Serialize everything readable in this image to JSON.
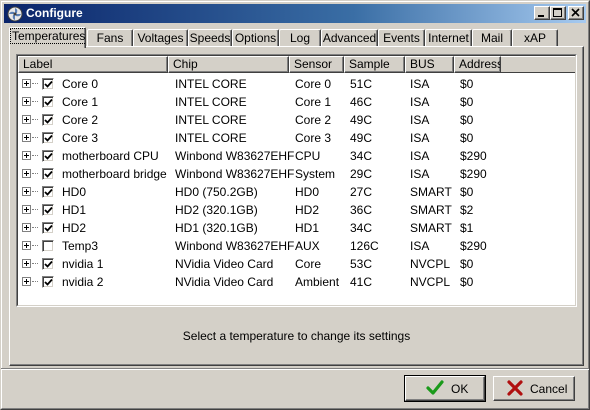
{
  "window": {
    "title": "Configure",
    "icon": "fan-icon",
    "controls": [
      "minimize-icon",
      "maximize-icon",
      "close-icon"
    ]
  },
  "tabs": [
    {
      "label": "Temperatures",
      "active": true
    },
    {
      "label": "Fans"
    },
    {
      "label": "Voltages"
    },
    {
      "label": "Speeds"
    },
    {
      "label": "Options"
    },
    {
      "label": "Log"
    },
    {
      "label": "Advanced"
    },
    {
      "label": "Events"
    },
    {
      "label": "Internet"
    },
    {
      "label": "Mail"
    },
    {
      "label": "xAP"
    }
  ],
  "list": {
    "columns": [
      "Label",
      "Chip",
      "Sensor",
      "Sample",
      "BUS",
      "Address"
    ],
    "rows": [
      {
        "label": "Core 0",
        "checked": true,
        "chip": "INTEL CORE",
        "sensor": "Core 0",
        "sample": "51C",
        "bus": "ISA",
        "address": "$0"
      },
      {
        "label": "Core 1",
        "checked": true,
        "chip": "INTEL CORE",
        "sensor": "Core 1",
        "sample": "46C",
        "bus": "ISA",
        "address": "$0"
      },
      {
        "label": "Core 2",
        "checked": true,
        "chip": "INTEL CORE",
        "sensor": "Core 2",
        "sample": "49C",
        "bus": "ISA",
        "address": "$0"
      },
      {
        "label": "Core 3",
        "checked": true,
        "chip": "INTEL CORE",
        "sensor": "Core 3",
        "sample": "49C",
        "bus": "ISA",
        "address": "$0"
      },
      {
        "label": "motherboard CPU",
        "checked": true,
        "chip": "Winbond W83627EHF",
        "sensor": "CPU",
        "sample": "34C",
        "bus": "ISA",
        "address": "$290"
      },
      {
        "label": "motherboard bridge",
        "checked": true,
        "chip": "Winbond W83627EHF",
        "sensor": "System",
        "sample": "29C",
        "bus": "ISA",
        "address": "$290"
      },
      {
        "label": "HD0",
        "checked": true,
        "chip": "HD0 (750.2GB)",
        "sensor": "HD0",
        "sample": "27C",
        "bus": "SMART",
        "address": "$0"
      },
      {
        "label": "HD1",
        "checked": true,
        "chip": "HD2 (320.1GB)",
        "sensor": "HD2",
        "sample": "36C",
        "bus": "SMART",
        "address": "$2"
      },
      {
        "label": "HD2",
        "checked": true,
        "chip": "HD1 (320.1GB)",
        "sensor": "HD1",
        "sample": "34C",
        "bus": "SMART",
        "address": "$1"
      },
      {
        "label": "Temp3",
        "checked": false,
        "chip": "Winbond W83627EHF",
        "sensor": "AUX",
        "sample": "126C",
        "bus": "ISA",
        "address": "$290"
      },
      {
        "label": "nvidia 1",
        "checked": true,
        "chip": "NVidia Video Card",
        "sensor": "Core",
        "sample": "53C",
        "bus": "NVCPL",
        "address": "$0"
      },
      {
        "label": "nvidia 2",
        "checked": true,
        "chip": "NVidia Video Card",
        "sensor": "Ambient",
        "sample": "41C",
        "bus": "NVCPL",
        "address": "$0"
      }
    ]
  },
  "status_text": "Select a temperature to change its settings",
  "buttons": {
    "ok": {
      "label": "OK",
      "icon": "checkmark-icon",
      "color": "#1a9a1a"
    },
    "cancel": {
      "label": "Cancel",
      "icon": "x-icon",
      "color": "#b01010"
    }
  },
  "colors": {
    "titlebar_start": "#0a246a",
    "titlebar_end": "#a6caf0",
    "face": "#d4d0c8"
  }
}
